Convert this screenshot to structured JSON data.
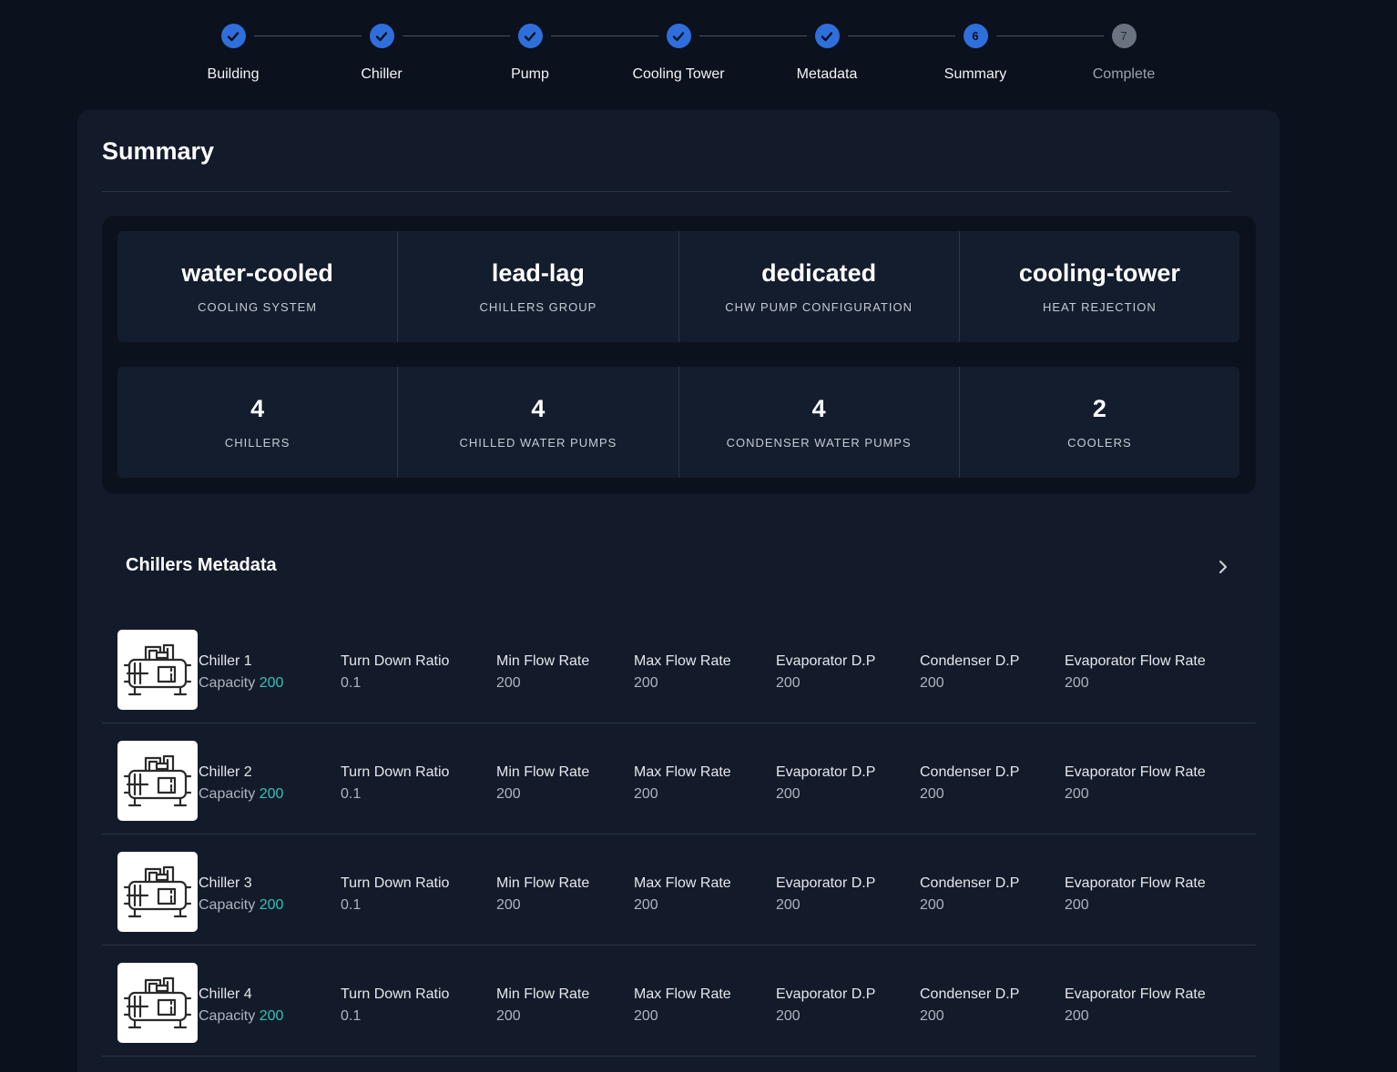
{
  "stepper": {
    "steps": [
      {
        "label": "Building",
        "state": "done",
        "num": ""
      },
      {
        "label": "Chiller",
        "state": "done",
        "num": ""
      },
      {
        "label": "Pump",
        "state": "done",
        "num": ""
      },
      {
        "label": "Cooling Tower",
        "state": "done",
        "num": ""
      },
      {
        "label": "Metadata",
        "state": "done",
        "num": ""
      },
      {
        "label": "Summary",
        "state": "active",
        "num": "6"
      },
      {
        "label": "Complete",
        "state": "pending",
        "num": "7"
      }
    ],
    "check_icon": "check-icon",
    "active_color": "#2f6fdc"
  },
  "summary": {
    "title": "Summary",
    "config": [
      {
        "value": "water-cooled",
        "label": "COOLING SYSTEM"
      },
      {
        "value": "lead-lag",
        "label": "CHILLERS GROUP"
      },
      {
        "value": "dedicated",
        "label": "CHW PUMP CONFIGURATION"
      },
      {
        "value": "cooling-tower",
        "label": "HEAT REJECTION"
      }
    ],
    "counts": [
      {
        "value": "4",
        "label": "CHILLERS"
      },
      {
        "value": "4",
        "label": "CHILLED WATER PUMPS"
      },
      {
        "value": "4",
        "label": "CONDENSER WATER PUMPS"
      },
      {
        "value": "2",
        "label": "COOLERS"
      }
    ]
  },
  "chillers_section": {
    "title": "Chillers Metadata",
    "expand_icon": "chevron-right-icon",
    "accent_color": "#2ec4b6",
    "rows": [
      {
        "name": "Chiller 1",
        "capacity_label": "Capacity",
        "capacity": "200",
        "fields": [
          {
            "label": "Turn Down Ratio",
            "value": "0.1"
          },
          {
            "label": "Min Flow Rate",
            "value": "200"
          },
          {
            "label": "Max Flow Rate",
            "value": "200"
          },
          {
            "label": "Evaporator D.P",
            "value": "200"
          },
          {
            "label": "Condenser D.P",
            "value": "200"
          },
          {
            "label": "Evaporator Flow Rate",
            "value": "200"
          }
        ]
      },
      {
        "name": "Chiller 2",
        "capacity_label": "Capacity",
        "capacity": "200",
        "fields": [
          {
            "label": "Turn Down Ratio",
            "value": "0.1"
          },
          {
            "label": "Min Flow Rate",
            "value": "200"
          },
          {
            "label": "Max Flow Rate",
            "value": "200"
          },
          {
            "label": "Evaporator D.P",
            "value": "200"
          },
          {
            "label": "Condenser D.P",
            "value": "200"
          },
          {
            "label": "Evaporator Flow Rate",
            "value": "200"
          }
        ]
      },
      {
        "name": "Chiller 3",
        "capacity_label": "Capacity",
        "capacity": "200",
        "fields": [
          {
            "label": "Turn Down Ratio",
            "value": "0.1"
          },
          {
            "label": "Min Flow Rate",
            "value": "200"
          },
          {
            "label": "Max Flow Rate",
            "value": "200"
          },
          {
            "label": "Evaporator D.P",
            "value": "200"
          },
          {
            "label": "Condenser D.P",
            "value": "200"
          },
          {
            "label": "Evaporator Flow Rate",
            "value": "200"
          }
        ]
      },
      {
        "name": "Chiller 4",
        "capacity_label": "Capacity",
        "capacity": "200",
        "fields": [
          {
            "label": "Turn Down Ratio",
            "value": "0.1"
          },
          {
            "label": "Min Flow Rate",
            "value": "200"
          },
          {
            "label": "Max Flow Rate",
            "value": "200"
          },
          {
            "label": "Evaporator D.P",
            "value": "200"
          },
          {
            "label": "Condenser D.P",
            "value": "200"
          },
          {
            "label": "Evaporator Flow Rate",
            "value": "200"
          }
        ]
      }
    ]
  }
}
